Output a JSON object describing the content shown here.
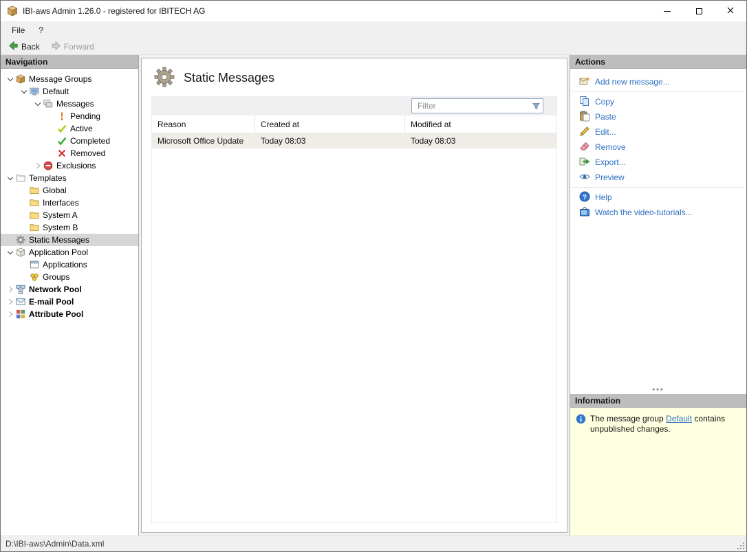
{
  "window": {
    "title": "IBI-aws Admin 1.26.0 - registered for IBITECH AG"
  },
  "menu": {
    "items": [
      {
        "label": "File"
      },
      {
        "label": "?"
      }
    ]
  },
  "toolbar": {
    "back": "Back",
    "forward": "Forward"
  },
  "navigation": {
    "header": "Navigation",
    "items": [
      {
        "label": "Message Groups",
        "level": 0,
        "expander": "expanded",
        "icon": "box-icon"
      },
      {
        "label": "Default",
        "level": 1,
        "expander": "expanded",
        "icon": "computer-icon"
      },
      {
        "label": "Messages",
        "level": 2,
        "expander": "expanded",
        "icon": "messages-icon"
      },
      {
        "label": "Pending",
        "level": 3,
        "expander": "none",
        "icon": "pending-icon"
      },
      {
        "label": "Active",
        "level": 3,
        "expander": "none",
        "icon": "active-icon"
      },
      {
        "label": "Completed",
        "level": 3,
        "expander": "none",
        "icon": "completed-icon"
      },
      {
        "label": "Removed",
        "level": 3,
        "expander": "none",
        "icon": "removed-icon"
      },
      {
        "label": "Exclusions",
        "level": 2,
        "expander": "collapsed",
        "icon": "exclusions-icon"
      },
      {
        "label": "Templates",
        "level": 0,
        "expander": "expanded",
        "icon": "templates-icon"
      },
      {
        "label": "Global",
        "level": 1,
        "expander": "none",
        "icon": "folder-icon"
      },
      {
        "label": "Interfaces",
        "level": 1,
        "expander": "none",
        "icon": "folder-icon"
      },
      {
        "label": "System A",
        "level": 1,
        "expander": "none",
        "icon": "folder-icon"
      },
      {
        "label": "System B",
        "level": 1,
        "expander": "none",
        "icon": "folder-icon"
      },
      {
        "label": "Static Messages",
        "level": 0,
        "expander": "none",
        "icon": "gear-icon",
        "selected": true
      },
      {
        "label": "Application Pool",
        "level": 0,
        "expander": "expanded",
        "icon": "app-pool-icon"
      },
      {
        "label": "Applications",
        "level": 1,
        "expander": "none",
        "icon": "applications-icon"
      },
      {
        "label": "Groups",
        "level": 1,
        "expander": "none",
        "icon": "groups-icon"
      },
      {
        "label": "Network Pool",
        "level": 0,
        "expander": "collapsed",
        "icon": "network-icon"
      },
      {
        "label": "E-mail Pool",
        "level": 0,
        "expander": "collapsed",
        "icon": "email-icon"
      },
      {
        "label": "Attribute Pool",
        "level": 0,
        "expander": "collapsed",
        "icon": "attribute-icon"
      }
    ]
  },
  "content": {
    "title": "Static Messages",
    "title_icon": "gear-icon",
    "filter_placeholder": "Filter",
    "table": {
      "columns": [
        "Reason",
        "Created at",
        "Modified at"
      ],
      "rows": [
        {
          "reason": "Microsoft Office Update",
          "created_at": "Today 08:03",
          "modified_at": "Today 08:03"
        }
      ]
    }
  },
  "actions": {
    "header": "Actions",
    "items": [
      {
        "label": "Add new message...",
        "icon": "add-message-icon"
      },
      {
        "label": "Copy",
        "icon": "copy-icon"
      },
      {
        "label": "Paste",
        "icon": "paste-icon"
      },
      {
        "label": "Edit...",
        "icon": "edit-icon"
      },
      {
        "label": "Remove",
        "icon": "remove-icon"
      },
      {
        "label": "Export...",
        "icon": "export-icon"
      },
      {
        "label": "Preview",
        "icon": "preview-icon"
      },
      {
        "label": "Help",
        "icon": "help-icon"
      },
      {
        "label": "Watch the video-tutorials...",
        "icon": "video-tutorials-icon"
      }
    ]
  },
  "information": {
    "header": "Information",
    "text_before": "The message group ",
    "link_label": "Default",
    "text_after": " contains unpublished changes."
  },
  "statusbar": {
    "path": "D:\\IBI-aws\\Admin\\Data.xml"
  },
  "colors": {
    "accent_link": "#2e6fc2",
    "info_panel_bg": "#ffffe1",
    "panel_header_bg": "#bdbdbd",
    "selected_row_bg": "#d6d6d6",
    "table_row_bg": "#f0ede8"
  }
}
